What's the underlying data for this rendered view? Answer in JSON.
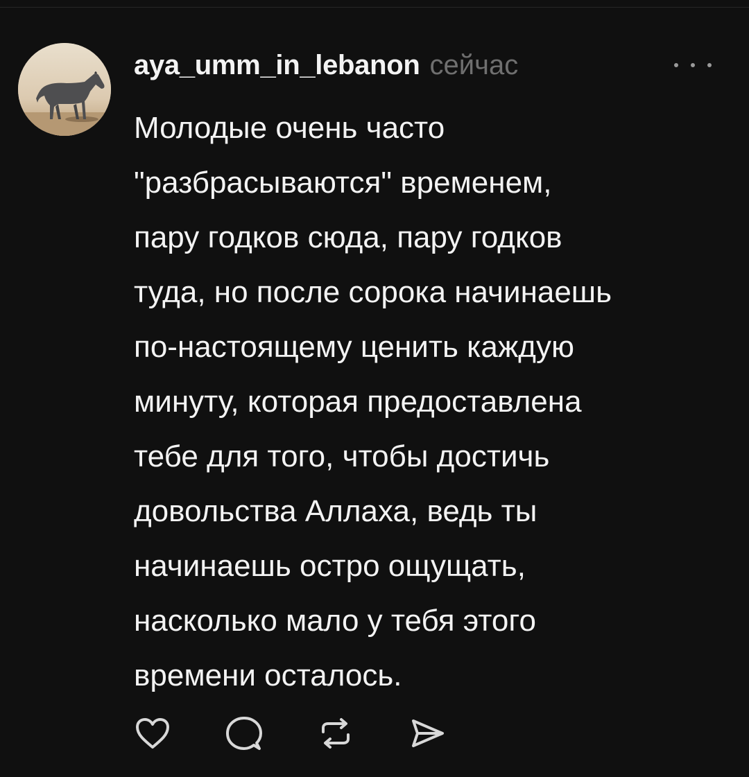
{
  "post": {
    "username": "aya_umm_in_lebanon",
    "timestamp": "сейчас",
    "text": "Молодые очень часто\n\"разбрасываются\" временем,\nпару годков сюда, пару годков\nтуда, но после сорока начинаешь\nпо-настоящему ценить каждую\nминуту, которая предоставлена\nтебе для того, чтобы достичь\nдовольства Аллаха, ведь ты\nначинаешь остро ощущать,\nнасколько мало у тебя этого\nвремени осталось."
  },
  "avatar": {
    "icon": "horse-photo-avatar",
    "colors": {
      "sky": "#e2d6c0",
      "ground": "#b59873",
      "horse": "#4e4e50"
    }
  },
  "actions": [
    {
      "name": "like",
      "icon": "heart-icon"
    },
    {
      "name": "reply",
      "icon": "comment-icon"
    },
    {
      "name": "repost",
      "icon": "repost-icon"
    },
    {
      "name": "share",
      "icon": "send-icon"
    }
  ],
  "theme": {
    "background": "#101010",
    "text": "#f3f3f3",
    "muted": "#6f6f6f",
    "icon": "#d8d8d8"
  }
}
